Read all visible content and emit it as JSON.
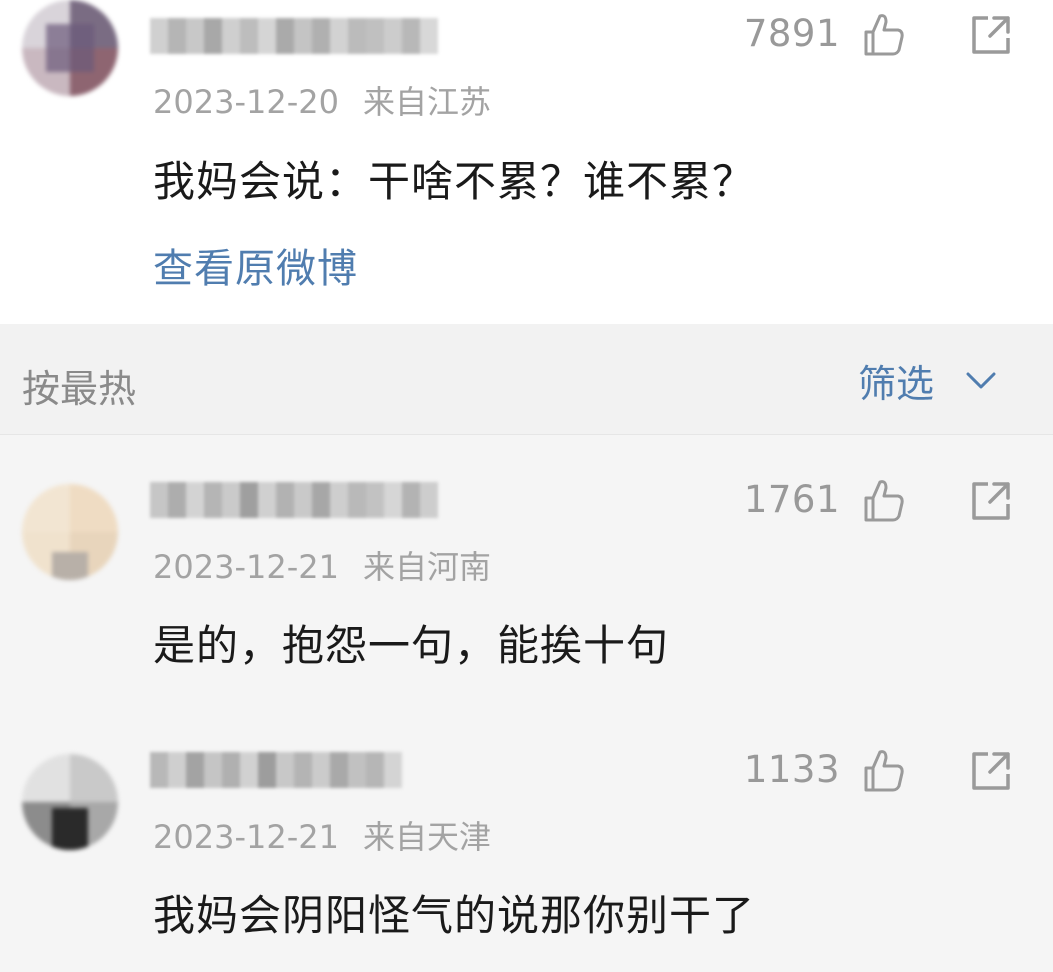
{
  "comments_top": {
    "count": "7891",
    "date": "2023-12-20",
    "location": "来自江苏",
    "text": "我妈会说：干啥不累？谁不累？",
    "view_original": "查看原微博"
  },
  "sort_bar": {
    "label": "按最热",
    "filter_label": "筛选"
  },
  "comments": [
    {
      "count": "1761",
      "date": "2023-12-21",
      "location": "来自河南",
      "text": "是的，抱怨一句，能挨十句"
    },
    {
      "count": "1133",
      "date": "2023-12-21",
      "location": "来自天津",
      "text": "我妈会阴阳怪气的说那你别干了"
    }
  ],
  "colors": {
    "link": "#507daf",
    "meta": "#a3a3a3",
    "text": "#1a1a1a"
  }
}
